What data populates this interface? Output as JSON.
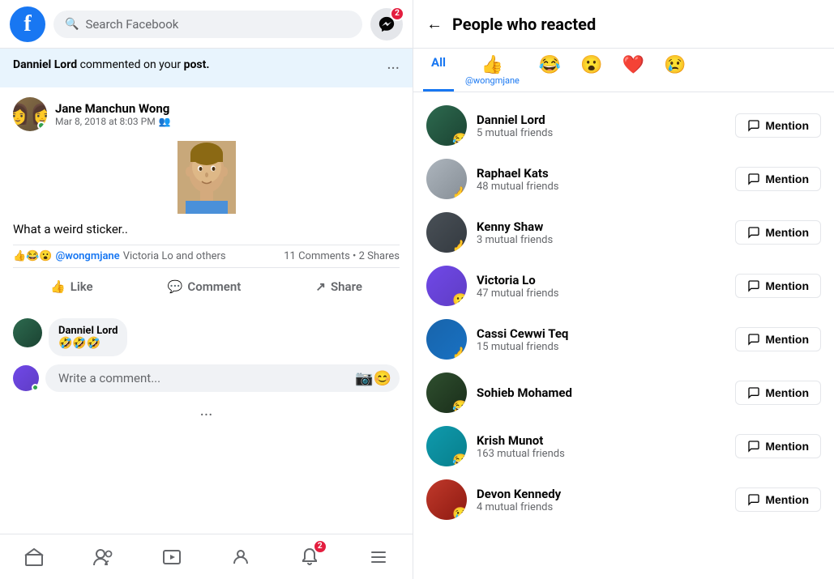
{
  "header": {
    "search_placeholder": "Search Facebook",
    "messenger_badge": "2",
    "fb_logo": "f"
  },
  "notification": {
    "author": "Danniel Lord",
    "text": "commented on your",
    "post_label": "post",
    "punctuation": "."
  },
  "post": {
    "author": "Jane Manchun Wong",
    "time": "Mar 8, 2018 at 8:03 PM",
    "text": "What a weird sticker..",
    "mention": "@wongmjane",
    "reactions_label": "Victoria Lo and others",
    "comments_label": "11 Comments • 2 Shares",
    "like_label": "Like",
    "comment_label": "Comment",
    "share_label": "Share"
  },
  "comment": {
    "author": "Danniel Lord",
    "text": "🤣🤣🤣",
    "input_placeholder": "Write a comment..."
  },
  "bottom_nav": {
    "notification_badge": "2"
  },
  "right_panel": {
    "title": "People who reacted",
    "tabs": [
      {
        "label": "All",
        "emoji": "",
        "active": true
      },
      {
        "label": "@wongmjane",
        "emoji": "👍",
        "active": false
      },
      {
        "label": "",
        "emoji": "😂",
        "active": false
      },
      {
        "label": "",
        "emoji": "😮",
        "active": false
      },
      {
        "label": "",
        "emoji": "❤️",
        "active": false
      },
      {
        "label": "",
        "emoji": "😢",
        "active": false
      }
    ],
    "people": [
      {
        "name": "Danniel Lord",
        "mutual": "5 mutual friends",
        "reaction": "😂",
        "avatar_class": "av-danniel"
      },
      {
        "name": "Raphael Kats",
        "mutual": "48 mutual friends",
        "reaction": "👍",
        "avatar_class": "av-raphael"
      },
      {
        "name": "Kenny Shaw",
        "mutual": "3 mutual friends",
        "reaction": "👍",
        "avatar_class": "av-kenny"
      },
      {
        "name": "Victoria Lo",
        "mutual": "47 mutual friends",
        "reaction": "😮",
        "avatar_class": "av-victoria"
      },
      {
        "name": "Cassi Cewwi Teq",
        "mutual": "15 mutual friends",
        "reaction": "👍",
        "avatar_class": "av-cassi"
      },
      {
        "name": "Sohieb Mohamed",
        "mutual": "",
        "reaction": "😂",
        "avatar_class": "av-sohieb"
      },
      {
        "name": "Krish Munot",
        "mutual": "163 mutual friends",
        "reaction": "😂",
        "avatar_class": "av-krish"
      },
      {
        "name": "Devon Kennedy",
        "mutual": "4 mutual friends",
        "reaction": "😢",
        "avatar_class": "av-devon"
      }
    ],
    "mention_label": "Mention"
  }
}
